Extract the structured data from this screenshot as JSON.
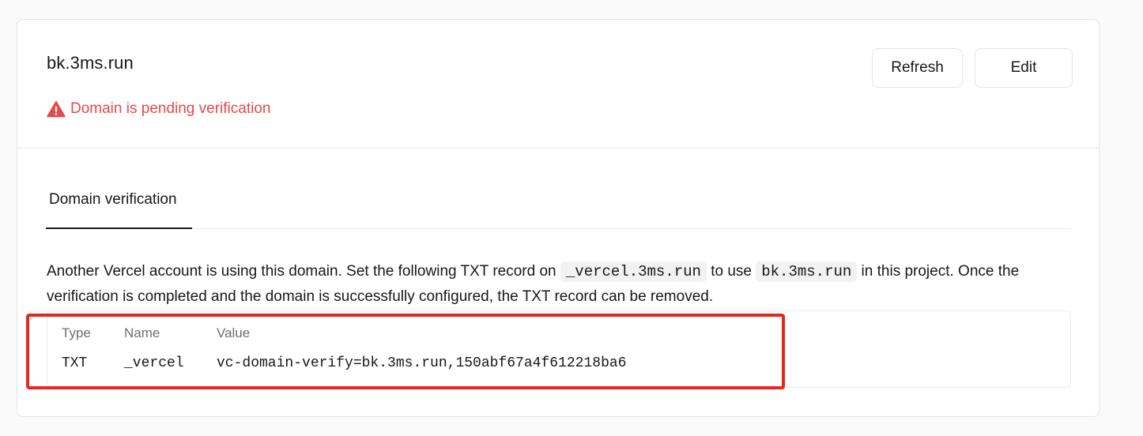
{
  "domain": {
    "name": "bk.3ms.run",
    "status_text": "Domain is pending verification",
    "status_icon": "warning-icon"
  },
  "actions": {
    "refresh_label": "Refresh",
    "edit_label": "Edit"
  },
  "tabs": [
    {
      "label": "Domain verification",
      "active": true
    }
  ],
  "verification": {
    "desc_part1": "Another Vercel account is using this domain. Set the following TXT record on ",
    "record_host": "_vercel.3ms.run",
    "desc_part2": " to use ",
    "domain_code": "bk.3ms.run",
    "desc_part3": " in this project. Once the verification is completed and the domain is successfully configured, the TXT record can be removed.",
    "table": {
      "headers": [
        "Type",
        "Name",
        "Value"
      ],
      "row": {
        "type": "TXT",
        "name": "_vercel",
        "value": "vc-domain-verify=bk.3ms.run,150abf67a4f612218ba6"
      }
    }
  },
  "colors": {
    "error": "#e5484d",
    "annotation": "#e8261f",
    "text": "#171717",
    "muted": "#6f6f6f"
  }
}
